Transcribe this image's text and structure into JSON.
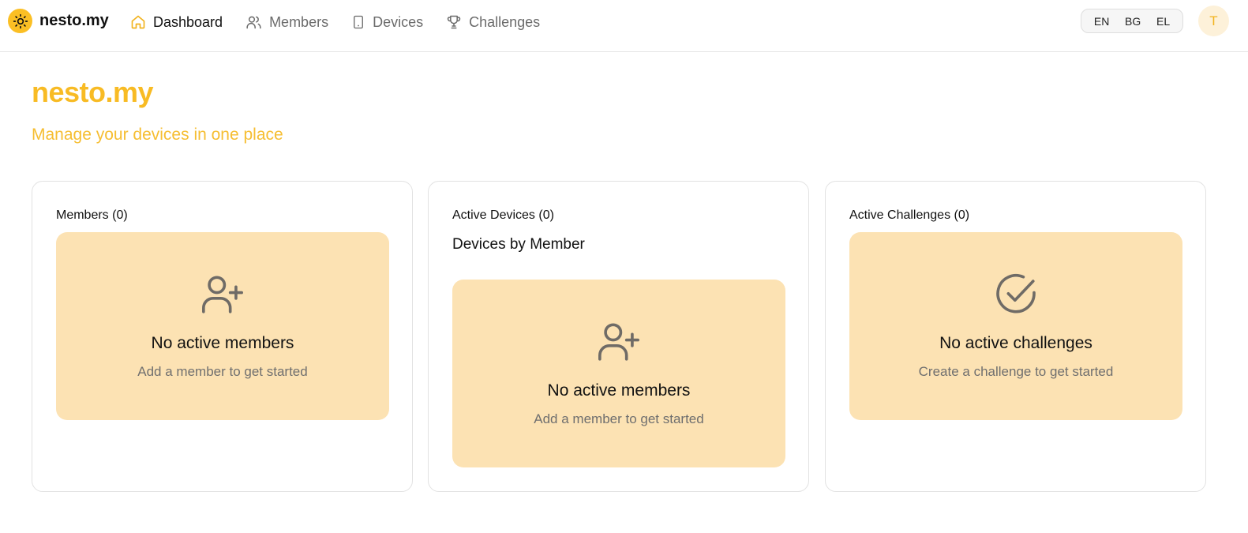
{
  "brand": {
    "name": "nesto.my",
    "icon": "sun-icon"
  },
  "nav": {
    "items": [
      {
        "label": "Dashboard",
        "icon": "home-icon",
        "active": true
      },
      {
        "label": "Members",
        "icon": "users-icon",
        "active": false
      },
      {
        "label": "Devices",
        "icon": "tablet-icon",
        "active": false
      },
      {
        "label": "Challenges",
        "icon": "trophy-icon",
        "active": false
      }
    ]
  },
  "languages": [
    "EN",
    "BG",
    "EL"
  ],
  "user": {
    "initial": "T"
  },
  "header": {
    "title": "nesto.my",
    "subtitle": "Manage your devices in one place"
  },
  "cards": {
    "members": {
      "title": "Members (0)",
      "empty_title": "No active members",
      "empty_text": "Add a member to get started",
      "icon": "user-plus-icon"
    },
    "devices": {
      "title": "Active Devices (0)",
      "subtitle": "Devices by Member",
      "empty_title": "No active members",
      "empty_text": "Add a member to get started",
      "icon": "user-plus-icon"
    },
    "challenges": {
      "title": "Active Challenges (0)",
      "empty_title": "No active challenges",
      "empty_text": "Create a challenge to get started",
      "icon": "check-circle-icon"
    }
  },
  "colors": {
    "accent": "#f8bb24",
    "empty_bg": "#fce2b3",
    "avatar_bg": "#fdf1d9"
  }
}
